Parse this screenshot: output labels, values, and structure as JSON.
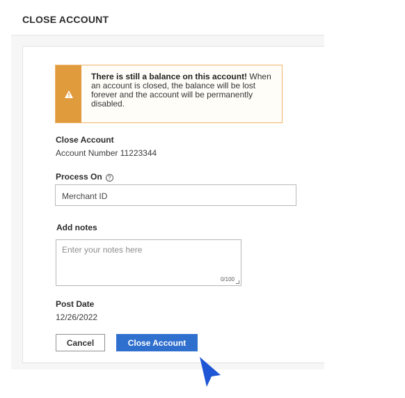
{
  "page": {
    "title": "CLOSE ACCOUNT"
  },
  "warning": {
    "strong": "There is still a balance on this account!",
    "line1_rest": " When",
    "line2": "an account is closed, the balance will be lost",
    "line3": "forever and the account will be permanently",
    "line4": "disabled.",
    "icon": "warning-icon"
  },
  "close_account": {
    "label": "Close Account",
    "account_number": "Account Number 11223344"
  },
  "process_on": {
    "label": "Process On",
    "help_icon": "help-icon",
    "value": "Merchant ID"
  },
  "notes": {
    "label": "Add notes",
    "placeholder": "Enter your notes here",
    "counter": "0/100"
  },
  "post_date": {
    "label": "Post Date",
    "value": "12/26/2022"
  },
  "buttons": {
    "cancel": "Cancel",
    "close": "Close Account"
  },
  "colors": {
    "accent": "#2f6fce",
    "warning": "#e09b3d",
    "warning_border": "#f0b46a",
    "cursor": "#1f56d6"
  }
}
